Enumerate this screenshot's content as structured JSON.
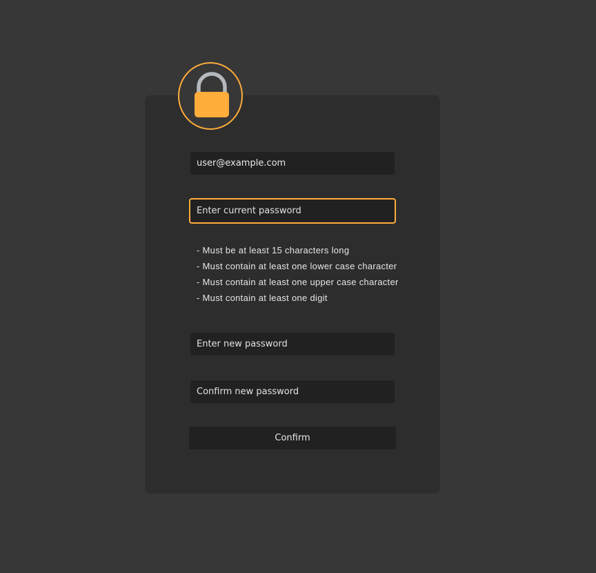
{
  "form": {
    "email_value": "user@example.com",
    "current_password_placeholder": "Enter current password",
    "new_password_placeholder": "Enter new password",
    "confirm_password_placeholder": "Confirm new password",
    "confirm_label": "Confirm"
  },
  "rules": [
    "- Must be at least 15 characters long",
    "- Must contain at least one lower case character",
    "- Must contain at least one upper case character",
    "- Must contain at least one digit"
  ],
  "icons": {
    "lock": "lock-icon"
  },
  "colors": {
    "accent": "#ffad3b",
    "background": "#373737",
    "card": "#2d2d2d",
    "field": "#212121",
    "shackle": "#b5b9bd"
  }
}
